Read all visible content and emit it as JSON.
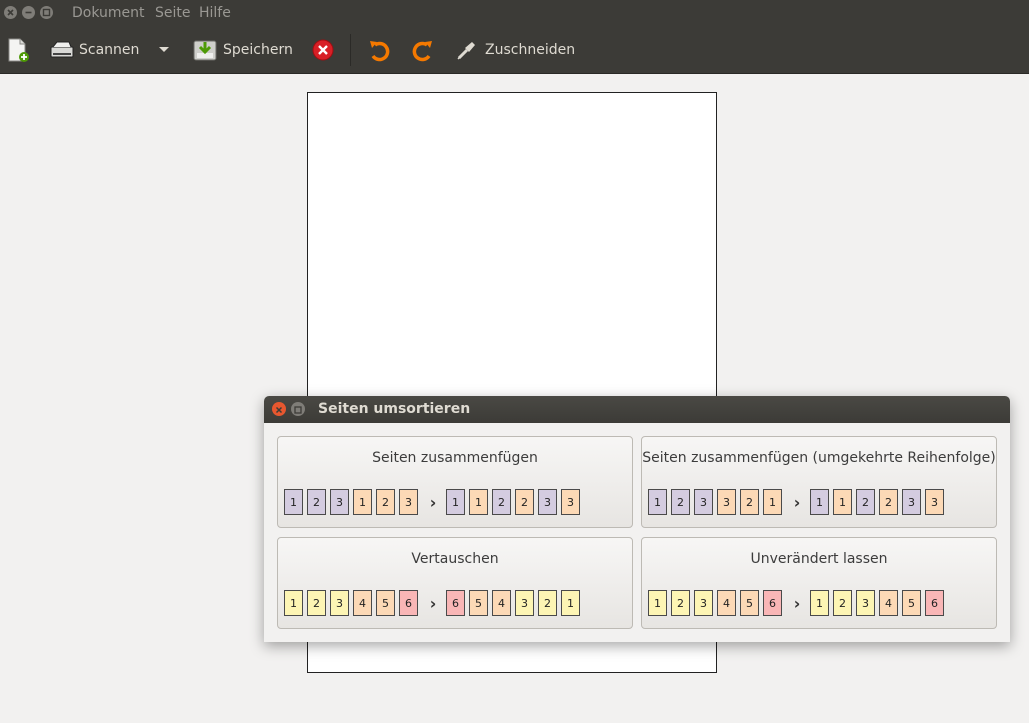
{
  "colors": {
    "purple": "#d4cce0",
    "orange": "#fcd9b6",
    "yellow": "#fdf5b4",
    "pink": "#f9b6b6",
    "close_red": "#e7572f"
  },
  "menubar": {
    "items": [
      "Dokument",
      "Seite",
      "Hilfe"
    ]
  },
  "toolbar": {
    "new_icon": "new-document-icon",
    "scan_label": "Scannen",
    "scan_menu_icon": "chevron-down-icon",
    "save_label": "Speichern",
    "stop_icon": "stop-icon",
    "rotate_left_icon": "rotate-left-icon",
    "rotate_right_icon": "rotate-right-icon",
    "crop_label": "Zuschneiden"
  },
  "dialog": {
    "title": "Seiten umsortieren",
    "options": [
      {
        "title": "Seiten zusammenfügen",
        "before": [
          [
            "1",
            "purple"
          ],
          [
            "2",
            "purple"
          ],
          [
            "3",
            "purple"
          ],
          [
            "1",
            "orange"
          ],
          [
            "2",
            "orange"
          ],
          [
            "3",
            "orange"
          ]
        ],
        "after": [
          [
            "1",
            "purple"
          ],
          [
            "1",
            "orange"
          ],
          [
            "2",
            "purple"
          ],
          [
            "2",
            "orange"
          ],
          [
            "3",
            "purple"
          ],
          [
            "3",
            "orange"
          ]
        ]
      },
      {
        "title": "Seiten zusammenfügen (umgekehrte Reihenfolge)",
        "before": [
          [
            "1",
            "purple"
          ],
          [
            "2",
            "purple"
          ],
          [
            "3",
            "purple"
          ],
          [
            "3",
            "orange"
          ],
          [
            "2",
            "orange"
          ],
          [
            "1",
            "orange"
          ]
        ],
        "after": [
          [
            "1",
            "purple"
          ],
          [
            "1",
            "orange"
          ],
          [
            "2",
            "purple"
          ],
          [
            "2",
            "orange"
          ],
          [
            "3",
            "purple"
          ],
          [
            "3",
            "orange"
          ]
        ]
      },
      {
        "title": "Vertauschen",
        "before": [
          [
            "1",
            "yellow"
          ],
          [
            "2",
            "yellow"
          ],
          [
            "3",
            "yellow"
          ],
          [
            "4",
            "orange"
          ],
          [
            "5",
            "orange"
          ],
          [
            "6",
            "pink"
          ]
        ],
        "after": [
          [
            "6",
            "pink"
          ],
          [
            "5",
            "orange"
          ],
          [
            "4",
            "orange"
          ],
          [
            "3",
            "yellow"
          ],
          [
            "2",
            "yellow"
          ],
          [
            "1",
            "yellow"
          ]
        ]
      },
      {
        "title": "Unverändert lassen",
        "before": [
          [
            "1",
            "yellow"
          ],
          [
            "2",
            "yellow"
          ],
          [
            "3",
            "yellow"
          ],
          [
            "4",
            "orange"
          ],
          [
            "5",
            "orange"
          ],
          [
            "6",
            "pink"
          ]
        ],
        "after": [
          [
            "1",
            "yellow"
          ],
          [
            "2",
            "yellow"
          ],
          [
            "3",
            "yellow"
          ],
          [
            "4",
            "orange"
          ],
          [
            "5",
            "orange"
          ],
          [
            "6",
            "pink"
          ]
        ]
      }
    ]
  }
}
